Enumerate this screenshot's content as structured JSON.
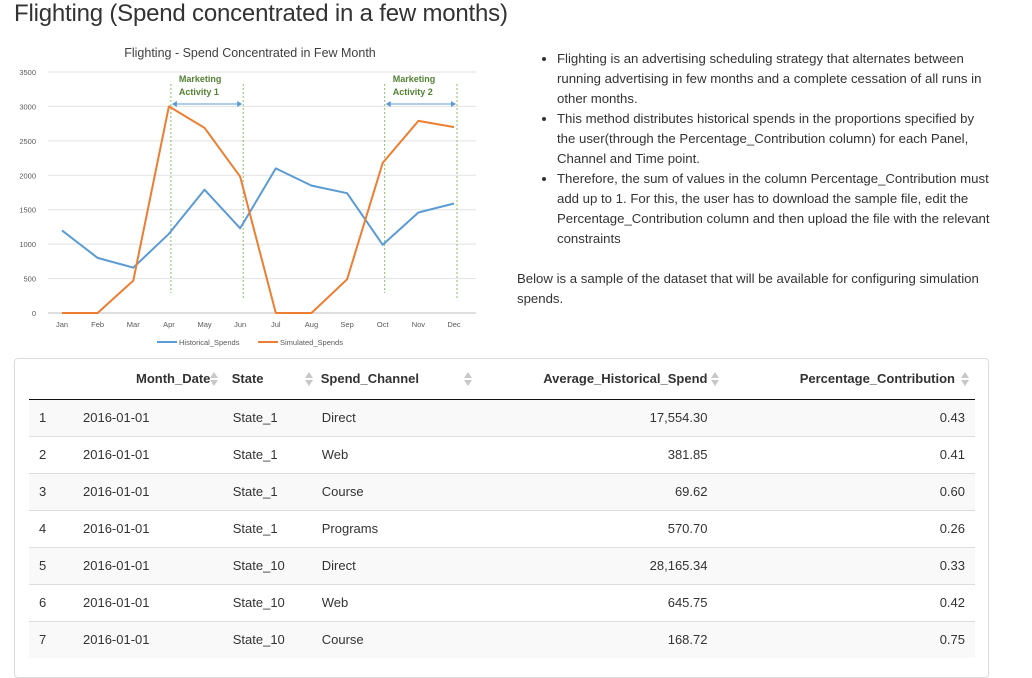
{
  "page": {
    "title": "Flighting (Spend concentrated in a few months)"
  },
  "chart_data": {
    "type": "line",
    "title": "Flighting - Spend Concentrated in Few Month",
    "categories": [
      "Jan",
      "Feb",
      "Mar",
      "Apr",
      "May",
      "Jun",
      "Jul",
      "Aug",
      "Sep",
      "Oct",
      "Nov",
      "Dec"
    ],
    "series": [
      {
        "name": "Historical_Spends",
        "color": "#5b9bd5",
        "values": [
          1200,
          800,
          660,
          1150,
          1790,
          1230,
          2100,
          1850,
          1740,
          990,
          1460,
          1590
        ]
      },
      {
        "name": "Simulated_Spends",
        "color": "#ed7d31",
        "values": [
          0,
          0,
          470,
          3000,
          2690,
          1980,
          0,
          0,
          490,
          2180,
          2790,
          2700
        ]
      }
    ],
    "yticks": [
      "0",
      "500",
      "1000",
      "1500",
      "2000",
      "2500",
      "3000",
      "3500"
    ],
    "ylim": [
      0,
      3500
    ],
    "grid": true,
    "legend": "bottom",
    "annotations": [
      {
        "label_line1": "Marketing",
        "label_line2": "Activity 1",
        "from": "Apr",
        "to": "Jun",
        "color": "#548235"
      },
      {
        "label_line1": "Marketing",
        "label_line2": "Activity 2",
        "from": "Oct",
        "to": "Dec",
        "color": "#548235"
      }
    ]
  },
  "description": {
    "bullets": [
      "Flighting is an advertising scheduling strategy that alternates between running advertising in few months and a complete cessation of all runs in other months.",
      "This method distributes historical spends in the proportions specified by the user(through the Percentage_Contribution column) for each Panel, Channel and Time point.",
      "Therefore, the sum of values in the column Percentage_Contribution must add up to 1. For this, the user has to download the sample file, edit the Percentage_Contribution column and then upload the file with the relevant constraints"
    ],
    "sample_note": "Below is a sample of the dataset that will be available for configuring simulation spends."
  },
  "table": {
    "headers": {
      "month_date": "Month_Date",
      "state": "State",
      "spend_channel": "Spend_Channel",
      "avg_hist": "Average_Historical_Spend",
      "pct": "Percentage_Contribution"
    },
    "rows": [
      {
        "idx": "1",
        "month_date": "2016-01-01",
        "state": "State_1",
        "spend_channel": "Direct",
        "avg_hist": "17,554.30",
        "pct": "0.43"
      },
      {
        "idx": "2",
        "month_date": "2016-01-01",
        "state": "State_1",
        "spend_channel": "Web",
        "avg_hist": "381.85",
        "pct": "0.41"
      },
      {
        "idx": "3",
        "month_date": "2016-01-01",
        "state": "State_1",
        "spend_channel": "Course",
        "avg_hist": "69.62",
        "pct": "0.60"
      },
      {
        "idx": "4",
        "month_date": "2016-01-01",
        "state": "State_1",
        "spend_channel": "Programs",
        "avg_hist": "570.70",
        "pct": "0.26"
      },
      {
        "idx": "5",
        "month_date": "2016-01-01",
        "state": "State_10",
        "spend_channel": "Direct",
        "avg_hist": "28,165.34",
        "pct": "0.33"
      },
      {
        "idx": "6",
        "month_date": "2016-01-01",
        "state": "State_10",
        "spend_channel": "Web",
        "avg_hist": "645.75",
        "pct": "0.42"
      },
      {
        "idx": "7",
        "month_date": "2016-01-01",
        "state": "State_10",
        "spend_channel": "Course",
        "avg_hist": "168.72",
        "pct": "0.75"
      }
    ]
  }
}
